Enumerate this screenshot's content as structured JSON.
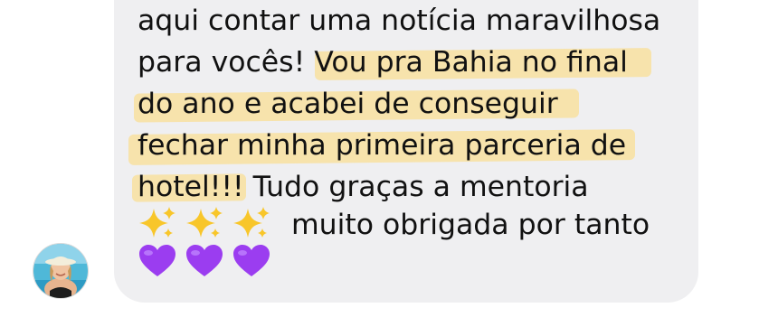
{
  "message": {
    "lines": [
      "aqui contar uma notícia maravilhosa",
      "para vocês!",
      "Vou pra Bahia no final",
      "do ano e acabei de conseguir",
      "fechar minha primeira parceria de",
      "hotel!!!",
      "Tudo graças a mentoria",
      "muito obrigada por tanto"
    ],
    "highlight_color": "#f7e2a8",
    "bubble_color": "#efeff1",
    "emojis": {
      "sparkles": [
        "sparkles-icon",
        "sparkles-icon",
        "sparkles-icon"
      ],
      "hearts": [
        "purple-heart-icon",
        "purple-heart-icon",
        "purple-heart-icon"
      ],
      "heart_color": "#9b3df0"
    }
  },
  "avatar": {
    "icon": "profile-photo"
  }
}
